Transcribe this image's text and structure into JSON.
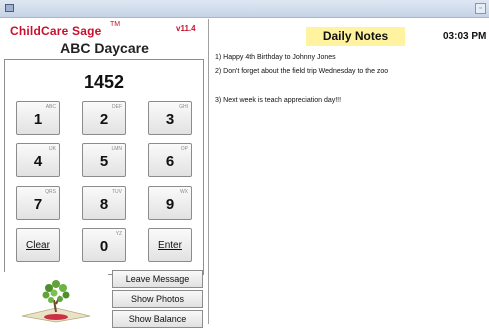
{
  "app": {
    "name": "ChildCare Sage",
    "trademark": "TM",
    "version": "v11.4",
    "company": "ABC Daycare"
  },
  "keypad": {
    "code_display": "1452",
    "keys": [
      {
        "digit": "1",
        "letters": "ABC"
      },
      {
        "digit": "2",
        "letters": "DEF"
      },
      {
        "digit": "3",
        "letters": "GHI"
      },
      {
        "digit": "4",
        "letters": "IJK"
      },
      {
        "digit": "5",
        "letters": "LMN"
      },
      {
        "digit": "6",
        "letters": "OP"
      },
      {
        "digit": "7",
        "letters": "QRS"
      },
      {
        "digit": "8",
        "letters": "TUV"
      },
      {
        "digit": "9",
        "letters": "WX"
      },
      {
        "digit": "0",
        "letters": "YZ"
      }
    ],
    "clear_label": "Clear",
    "enter_label": "Enter"
  },
  "side_buttons": {
    "leave_message": "Leave Message",
    "show_photos": "Show Photos",
    "show_balance": "Show Balance"
  },
  "notes": {
    "title": "Daily Notes",
    "clock": "03:03 PM",
    "lines": [
      "1) Happy 4th Birthday to Johnny Jones",
      "2) Don't forget about the field trip Wednesday to the zoo",
      "3) Next week is teach appreciation day!!!"
    ]
  },
  "colors": {
    "brand_red": "#c8102e",
    "notes_title_bg": "#fff3a0"
  }
}
